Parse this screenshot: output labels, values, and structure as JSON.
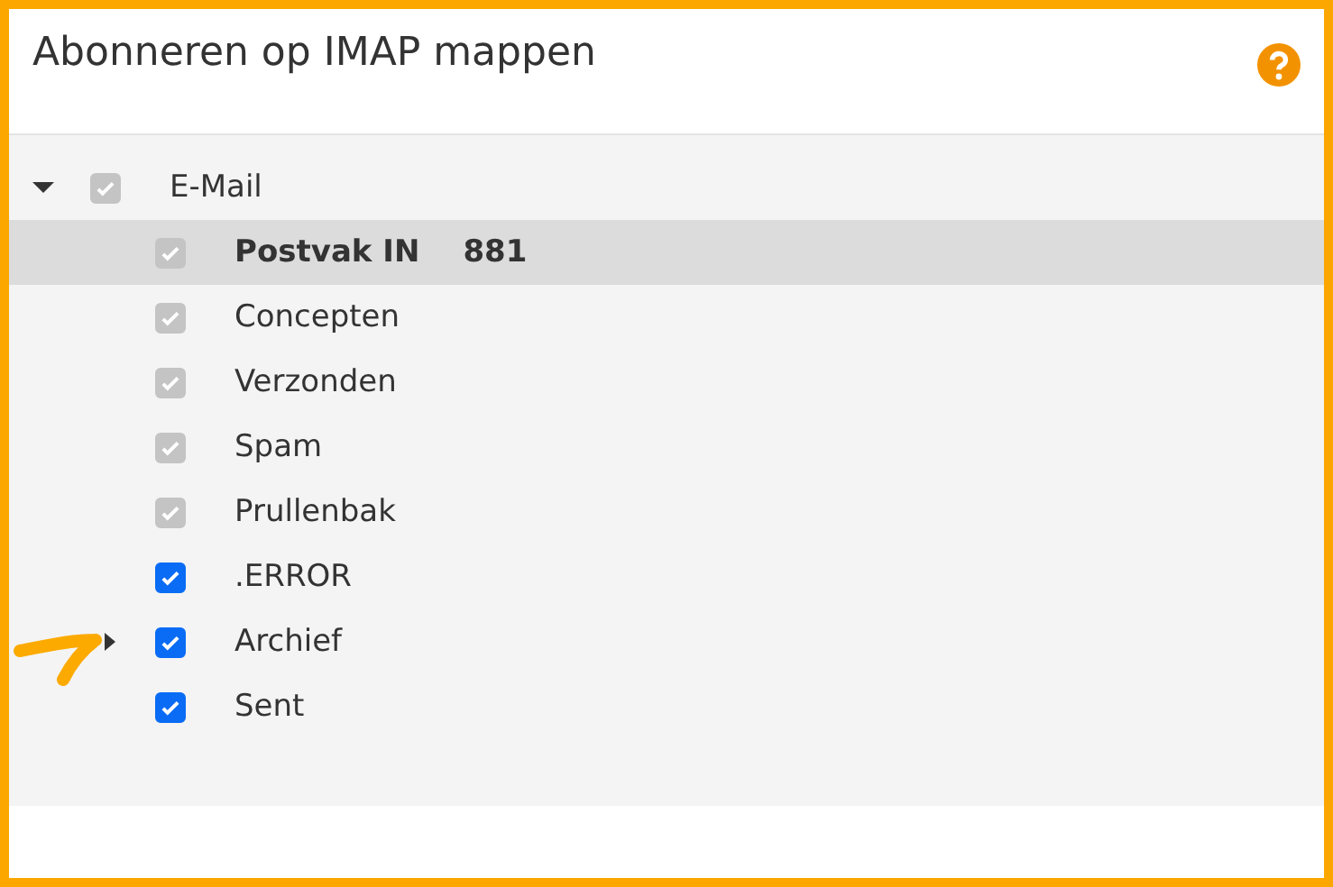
{
  "dialog": {
    "title": "Abonneren op IMAP mappen"
  },
  "tree": [
    {
      "label": "E-Mail",
      "expanded": true,
      "checked": true,
      "disabled": true,
      "selected": false,
      "children": [
        {
          "label": "Postvak IN",
          "count": "881",
          "checked": true,
          "disabled": true,
          "selected": true
        },
        {
          "label": "Concepten",
          "checked": true,
          "disabled": true,
          "selected": false
        },
        {
          "label": "Verzonden",
          "checked": true,
          "disabled": true,
          "selected": false
        },
        {
          "label": "Spam",
          "checked": true,
          "disabled": true,
          "selected": false
        },
        {
          "label": "Prullenbak",
          "checked": true,
          "disabled": true,
          "selected": false
        },
        {
          "label": ".ERROR",
          "checked": true,
          "disabled": false,
          "selected": false
        },
        {
          "label": "Archief",
          "expanded": false,
          "checked": true,
          "disabled": false,
          "selected": false
        },
        {
          "label": "Sent",
          "checked": true,
          "disabled": false,
          "selected": false
        }
      ]
    }
  ]
}
